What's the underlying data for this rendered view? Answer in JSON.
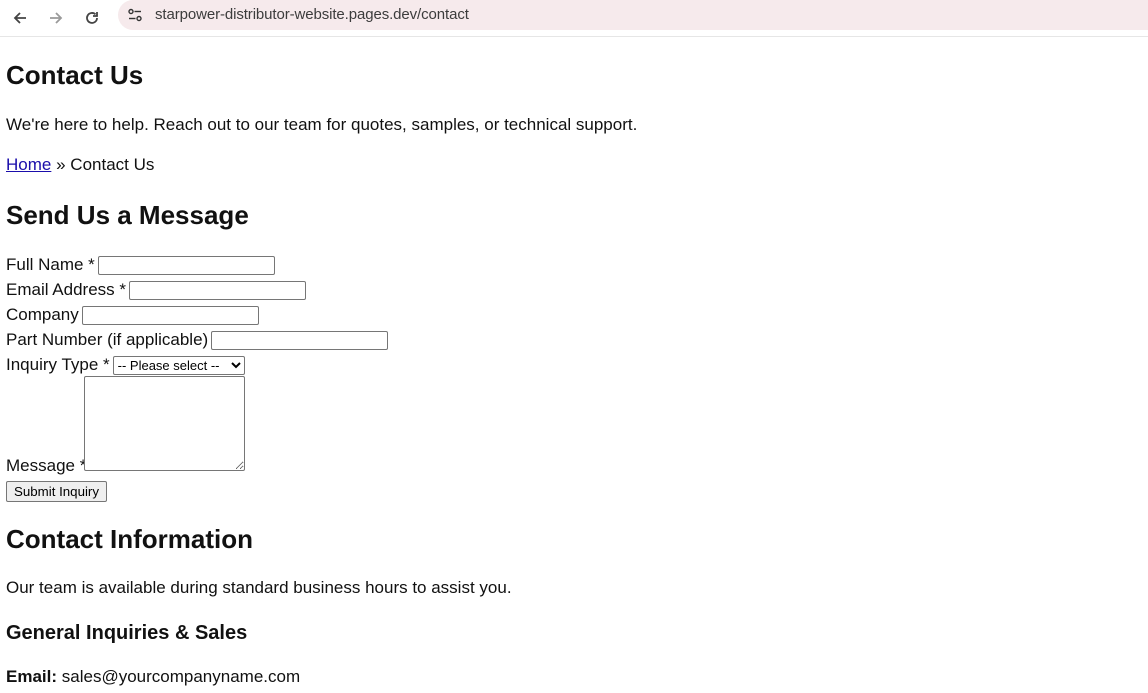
{
  "browser": {
    "url": "starpower-distributor-website.pages.dev/contact"
  },
  "page": {
    "title": "Contact Us",
    "intro": "We're here to help. Reach out to our team for quotes, samples, or technical support.",
    "breadcrumb": {
      "home": "Home",
      "separator": "»",
      "current": "Contact Us"
    }
  },
  "form": {
    "heading": "Send Us a Message",
    "full_name_label": "Full Name *",
    "full_name_value": "",
    "email_label": "Email Address *",
    "email_value": "",
    "company_label": "Company",
    "company_value": "",
    "part_number_label": "Part Number (if applicable)",
    "part_number_value": "",
    "inquiry_label": "Inquiry Type *",
    "inquiry_selected": "-- Please select --",
    "message_label": "Message *",
    "message_value": "",
    "submit_label": "Submit Inquiry"
  },
  "contact": {
    "heading": "Contact Information",
    "description": "Our team is available during standard business hours to assist you.",
    "general_heading": "General Inquiries & Sales",
    "email_label": "Email:",
    "email_value": "sales@yourcompanyname.com"
  }
}
